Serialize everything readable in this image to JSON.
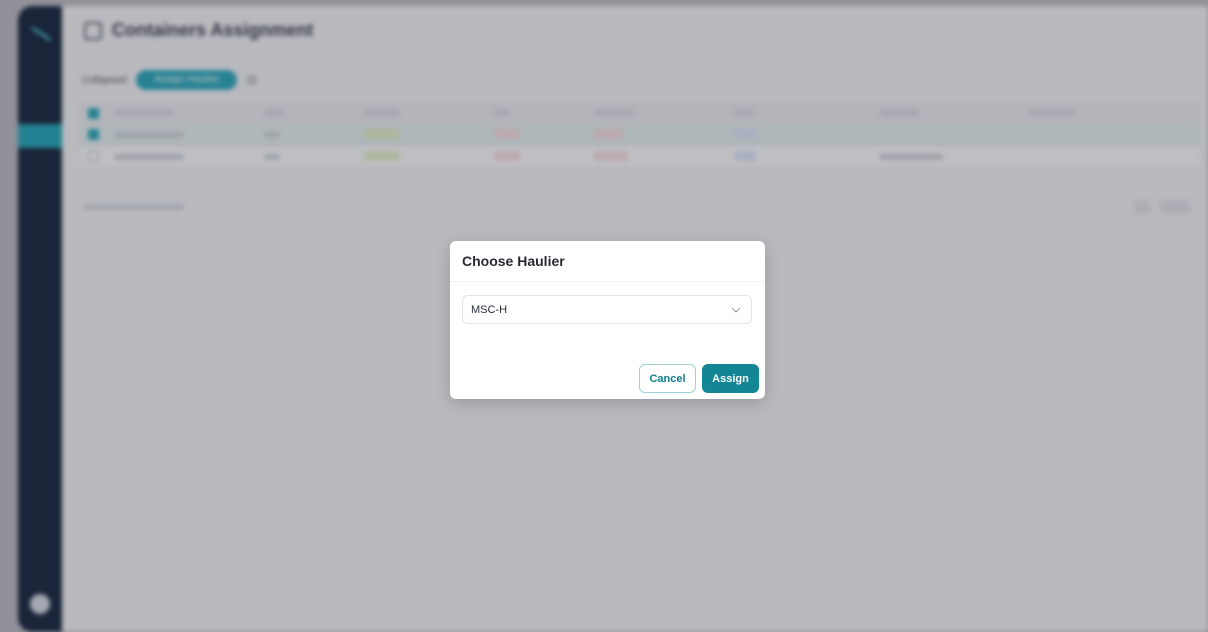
{
  "page": {
    "title": "Containers Assignment"
  },
  "toolbar": {
    "filter_label": "Collapsed",
    "primary_pill": "Assign Haulier"
  },
  "table": {
    "rows_selected": [
      true,
      false
    ]
  },
  "modal": {
    "title": "Choose Haulier",
    "select": {
      "value": "MSC-H"
    },
    "cancel_label": "Cancel",
    "assign_label": "Assign"
  },
  "colors": {
    "accent": "#138696",
    "sidebar": "#0a1a33"
  }
}
